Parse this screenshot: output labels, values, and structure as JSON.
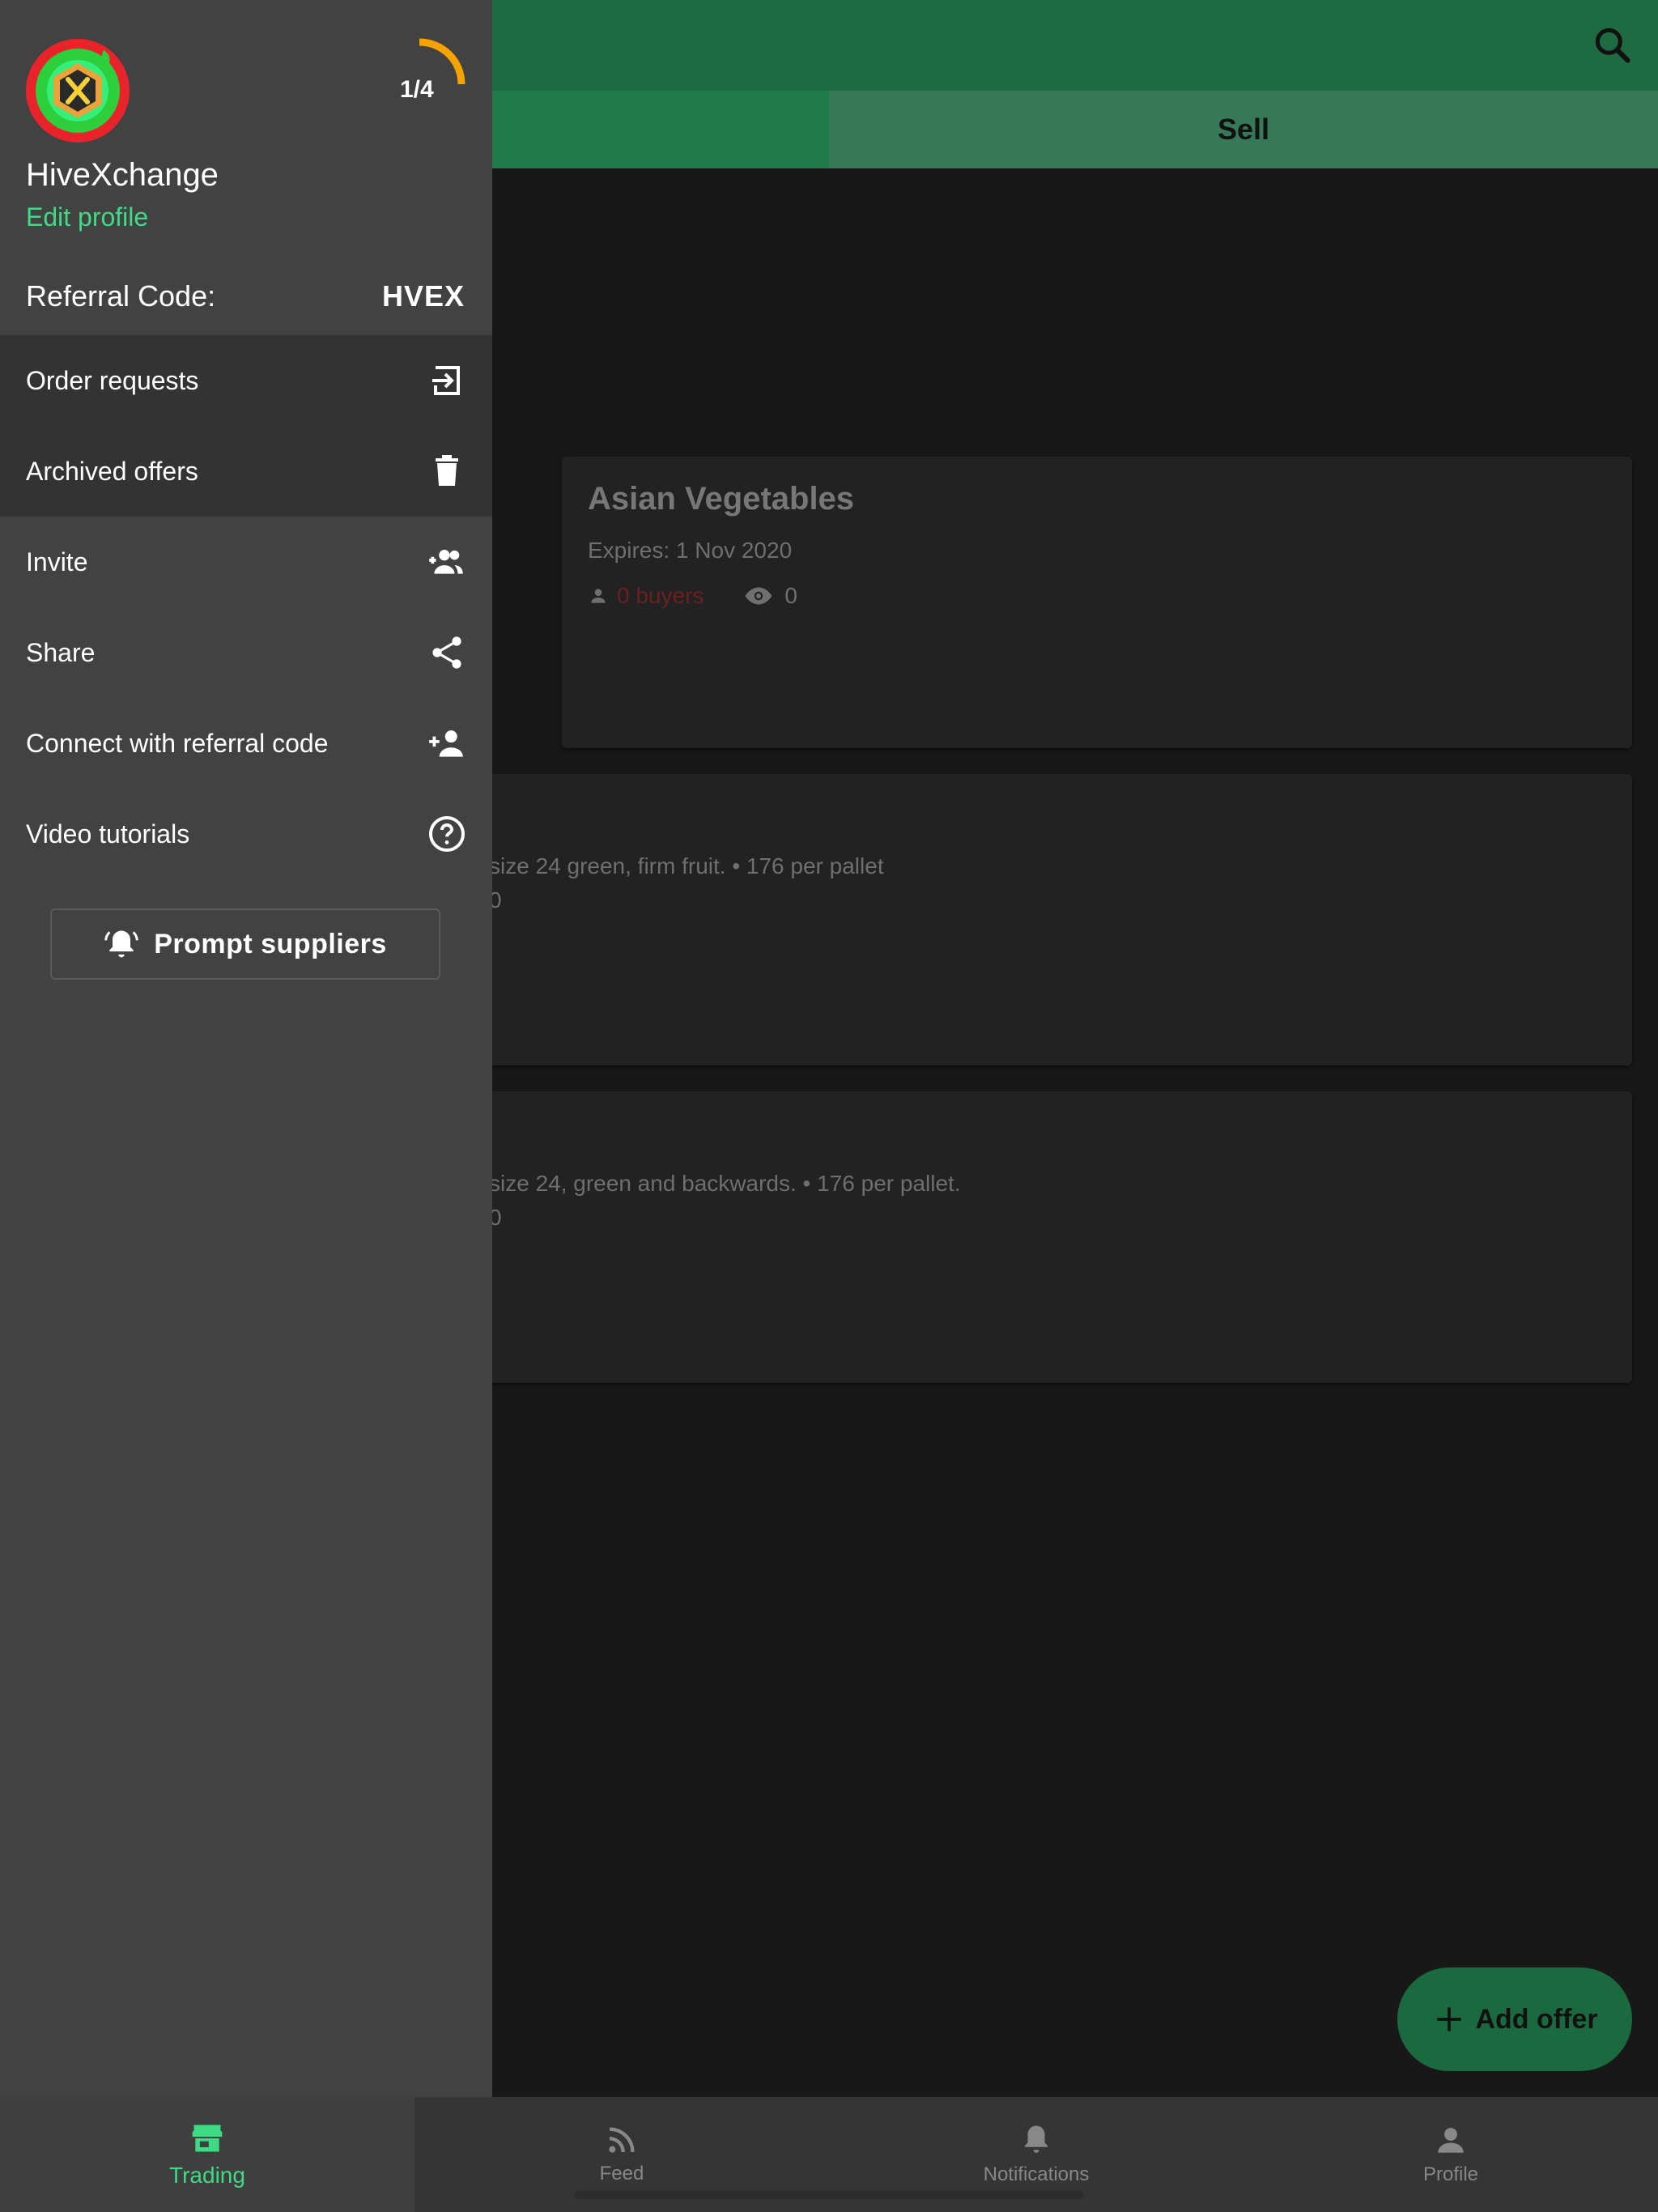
{
  "main": {
    "tabs": [
      {
        "label": ""
      },
      {
        "label": "Sell"
      }
    ],
    "cards": [
      {
        "title": "Asian Vegetables",
        "expiry": "Expires: 1 Nov 2020",
        "buyers": "0 buyers",
        "views": "0"
      },
      {
        "description": "size 24 green, firm fruit. • 176 per pallet",
        "meta": "0"
      },
      {
        "description": "size 24, green and backwards. • 176 per pallet.",
        "meta": "0"
      }
    ],
    "fab_label": "Add offer"
  },
  "drawer": {
    "app_name": "HiveXchange",
    "edit_profile": "Edit profile",
    "progress": "1/4",
    "progress_fraction": 0.25,
    "referral_label": "Referral Code:",
    "referral_code": "HVEX",
    "menu": [
      {
        "label": "Order requests",
        "icon": "login-icon"
      },
      {
        "label": "Archived offers",
        "icon": "trash-icon"
      },
      {
        "label": "Invite",
        "icon": "group-add-icon"
      },
      {
        "label": "Share",
        "icon": "share-icon"
      },
      {
        "label": "Connect with referral code",
        "icon": "person-add-icon"
      },
      {
        "label": "Video tutorials",
        "icon": "help-circle-icon"
      }
    ],
    "prompt_button": "Prompt suppliers"
  },
  "bottom_nav": [
    {
      "label": "Trading",
      "icon": "store-icon",
      "active": true
    },
    {
      "label": "Feed",
      "icon": "rss-icon",
      "active": false
    },
    {
      "label": "Notifications",
      "icon": "bell-icon",
      "active": false
    },
    {
      "label": "Profile",
      "icon": "person-icon",
      "active": false
    }
  ],
  "colors": {
    "accent": "#3ddc84",
    "appbar": "#1e6b41",
    "drawer": "#424242",
    "progress_arc": "#f5a300",
    "buyers_warning": "#6b2020"
  }
}
